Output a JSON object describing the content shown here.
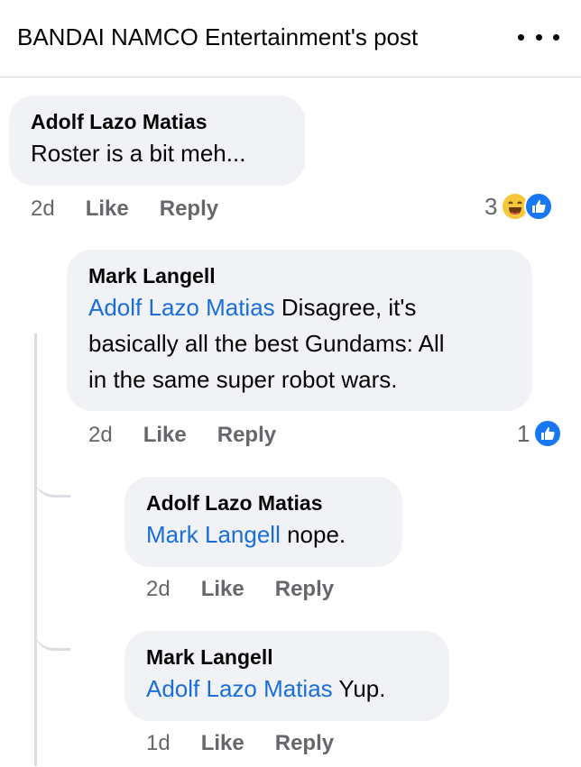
{
  "header": {
    "title": "BANDAI NAMCO Entertainment's post"
  },
  "comments": [
    {
      "author": "Adolf Lazo Matias",
      "mention": "",
      "text": "Roster is a bit meh...",
      "time": "2d",
      "like_label": "Like",
      "reply_label": "Reply",
      "reaction_count": "3",
      "reactions": [
        "haha-icon",
        "like-icon"
      ]
    },
    {
      "author": "Mark Langell",
      "mention": "Adolf Lazo Matias",
      "text_line1": " Disagree, it's",
      "text_line2": "basically all the best Gundams: All",
      "text_line3": "in the same super robot wars.",
      "time": "2d",
      "like_label": "Like",
      "reply_label": "Reply",
      "reaction_count": "1",
      "reactions": [
        "like-icon"
      ]
    },
    {
      "author": "Adolf Lazo Matias",
      "mention": "Mark Langell",
      "text": " nope.",
      "time": "2d",
      "like_label": "Like",
      "reply_label": "Reply"
    },
    {
      "author": "Mark Langell",
      "mention": "Adolf Lazo Matias",
      "text": " Yup.",
      "time": "1d",
      "like_label": "Like",
      "reply_label": "Reply"
    }
  ],
  "colors": {
    "mention": "#1a6ed8",
    "bubble": "#f0f2f5",
    "meta": "#65676b",
    "like_blue": "#1877f2"
  }
}
